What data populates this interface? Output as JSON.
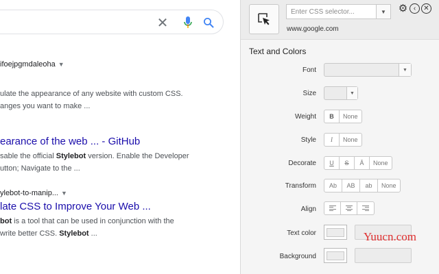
{
  "results": {
    "results": [
      {
        "crumb": "ifoejpgmdaleoha",
        "snippet_lines": [
          "ulate the appearance of any website with custom CSS.",
          "anges you want to make ..."
        ]
      },
      {
        "title": "earance of the web ... - GitHub",
        "snippet_line1_pre": "sable the official ",
        "snippet_line1_bold": "Stylebot",
        "snippet_line1_post": " version. Enable the Developer",
        "snippet_line2": "utton; Navigate to the ..."
      },
      {
        "crumb": "ylebot-to-manip...",
        "title": "late CSS to Improve Your Web ...",
        "snippet_line1_bold": "bot",
        "snippet_line1_post": " is a tool that can be used in conjunction with the",
        "snippet_line2_pre": "write better CSS. ",
        "snippet_line2_bold": "Stylebot",
        "snippet_line2_post": " ..."
      }
    ]
  },
  "panel": {
    "selector_placeholder": "Enter CSS selector...",
    "site_url": "www.google.com",
    "section_title": "Text and Colors",
    "labels": {
      "font": "Font",
      "size": "Size",
      "weight": "Weight",
      "style": "Style",
      "decorate": "Decorate",
      "transform": "Transform",
      "align": "Align",
      "text_color": "Text color",
      "background": "Background"
    },
    "weight_options": [
      "B",
      "None"
    ],
    "style_options": [
      "I",
      "None"
    ],
    "decorate_options": [
      "U",
      "S",
      "Ā",
      "None"
    ],
    "transform_options": [
      "Ab",
      "AB",
      "ab",
      "None"
    ]
  },
  "watermark": "Yuucn.com",
  "colors": {
    "link": "#1a0dab",
    "watermark": "#e03030",
    "panel_bg": "#f5f5f5"
  }
}
